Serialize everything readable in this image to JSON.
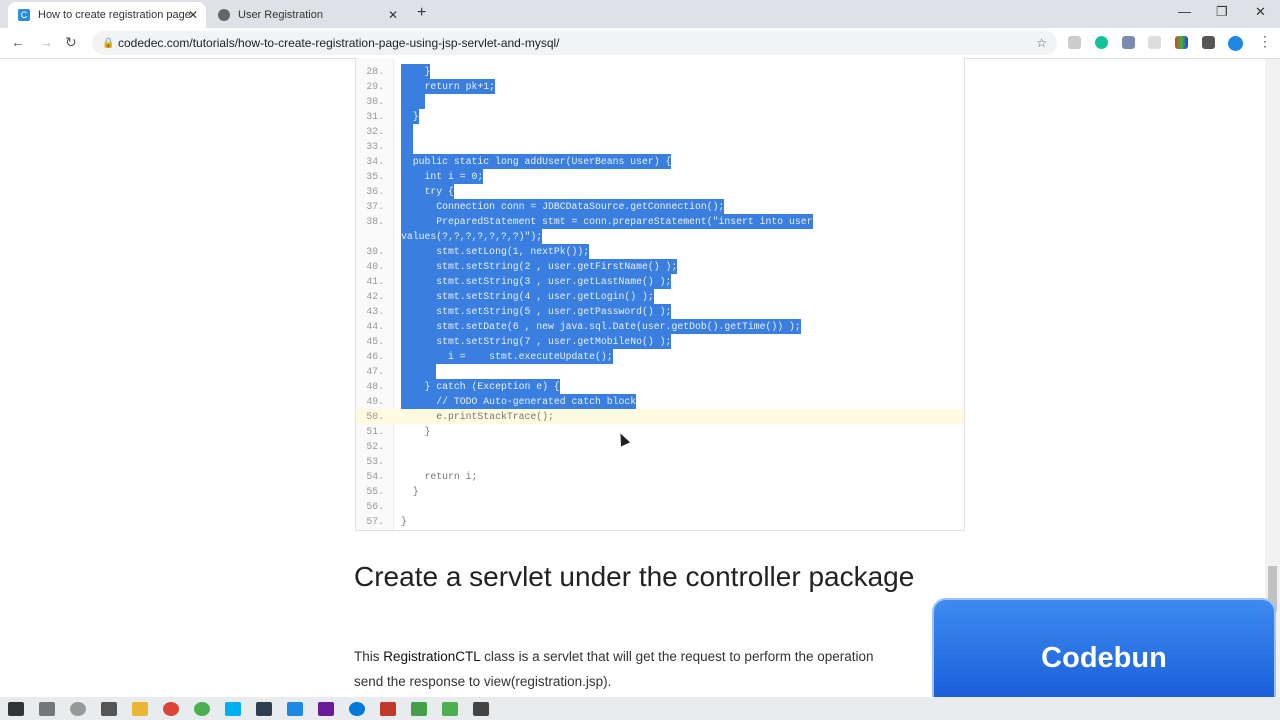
{
  "browser": {
    "tabs": [
      {
        "title": "How to create registration page",
        "favicon": "C",
        "active": true
      },
      {
        "title": "User Registration",
        "favicon": "globe-icon",
        "active": false
      }
    ],
    "url": "codedec.com/tutorials/how-to-create-registration-page-using-jsp-servlet-and-mysql/"
  },
  "code": {
    "lines": [
      {
        "n": "28.",
        "t": "    }",
        "sel": true
      },
      {
        "n": "29.",
        "t": "    return pk+1;",
        "sel": true
      },
      {
        "n": "30.",
        "t": "    ",
        "sel": true
      },
      {
        "n": "31.",
        "t": "  }",
        "sel": true
      },
      {
        "n": "32.",
        "t": "  ",
        "sel": true
      },
      {
        "n": "33.",
        "t": "  ",
        "sel": true
      },
      {
        "n": "34.",
        "t": "  public static long addUser(UserBeans user) {",
        "sel": true
      },
      {
        "n": "35.",
        "t": "    int i = 0;",
        "sel": true
      },
      {
        "n": "36.",
        "t": "    try {",
        "sel": true
      },
      {
        "n": "37.",
        "t": "      Connection conn = JDBCDataSource.getConnection();",
        "sel": true
      },
      {
        "n": "38.",
        "t": "      PreparedStatement stmt = conn.prepareStatement(\"insert into user",
        "sel": true
      },
      {
        "n": "",
        "t": "values(?,?,?,?,?,?,?)\");",
        "sel": true
      },
      {
        "n": "39.",
        "t": "      stmt.setLong(1, nextPk());",
        "sel": true
      },
      {
        "n": "40.",
        "t": "      stmt.setString(2 , user.getFirstName() );",
        "sel": true
      },
      {
        "n": "41.",
        "t": "      stmt.setString(3 , user.getLastName() );",
        "sel": true
      },
      {
        "n": "42.",
        "t": "      stmt.setString(4 , user.getLogin() );",
        "sel": true
      },
      {
        "n": "43.",
        "t": "      stmt.setString(5 , user.getPassword() );",
        "sel": true
      },
      {
        "n": "44.",
        "t": "      stmt.setDate(6 , new java.sql.Date(user.getDob().getTime()) );",
        "sel": true
      },
      {
        "n": "45.",
        "t": "      stmt.setString(7 , user.getMobileNo() );",
        "sel": true
      },
      {
        "n": "46.",
        "t": "        i =    stmt.executeUpdate();",
        "sel": true
      },
      {
        "n": "47.",
        "t": "      ",
        "sel": true
      },
      {
        "n": "48.",
        "t": "    } catch (Exception e) {",
        "sel": true
      },
      {
        "n": "49.",
        "t": "      // TODO Auto-generated catch block",
        "sel": true
      },
      {
        "n": "50.",
        "t": "      e.printStackTrace();",
        "sel": false,
        "current": true
      },
      {
        "n": "51.",
        "t": "    }",
        "sel": false
      },
      {
        "n": "52.",
        "t": "",
        "sel": false
      },
      {
        "n": "53.",
        "t": "",
        "sel": false
      },
      {
        "n": "54.",
        "t": "    return i;",
        "sel": false
      },
      {
        "n": "55.",
        "t": "  }",
        "sel": false
      },
      {
        "n": "56.",
        "t": "",
        "sel": false
      },
      {
        "n": "57.",
        "t": "}",
        "sel": false
      }
    ]
  },
  "article": {
    "heading": "Create a servlet under the controller package",
    "para_pre": "This ",
    "para_bold": "RegistrationCTL",
    "para_post": " class is a servlet that will get the request to perform the operation",
    "para_line2": "send the response to view(registration.jsp)."
  },
  "overlay": {
    "text": "Codebun"
  },
  "colors": {
    "selection": "#3a7fe0",
    "overlay": "#1e63e0"
  }
}
